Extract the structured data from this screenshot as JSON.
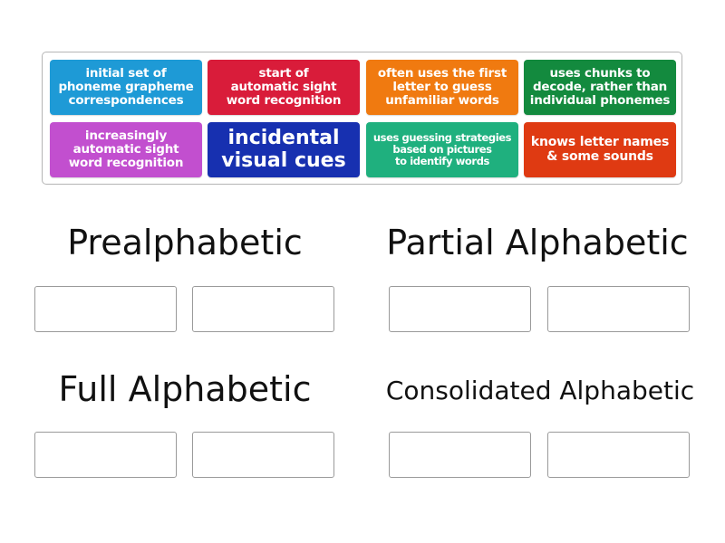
{
  "tile_bank": {
    "tiles": [
      {
        "label": "initial set of\nphoneme grapheme\ncorrespondences",
        "color": "#1e9ad6"
      },
      {
        "label": "start of\nautomatic sight\nword recognition",
        "color": "#d91c3a"
      },
      {
        "label": "often uses the first\nletter to guess\nunfamiliar words",
        "color": "#f07a10"
      },
      {
        "label": "uses chunks to\ndecode, rather than\nindividual phonemes",
        "color": "#138a3e"
      },
      {
        "label": "increasingly\nautomatic sight\nword recognition",
        "color": "#c24fcf"
      },
      {
        "label": "incidental\nvisual cues",
        "color": "#1730b0"
      },
      {
        "label": "uses guessing strategies\nbased on pictures\nto identify words",
        "color": "#1fb07e"
      },
      {
        "label": "knows letter names\n& some sounds",
        "color": "#df3a12"
      }
    ]
  },
  "groups": [
    {
      "title": "Prealphabetic"
    },
    {
      "title": "Partial Alphabetic"
    },
    {
      "title": "Full Alphabetic"
    },
    {
      "title": "Consolidated Alphabetic"
    }
  ]
}
